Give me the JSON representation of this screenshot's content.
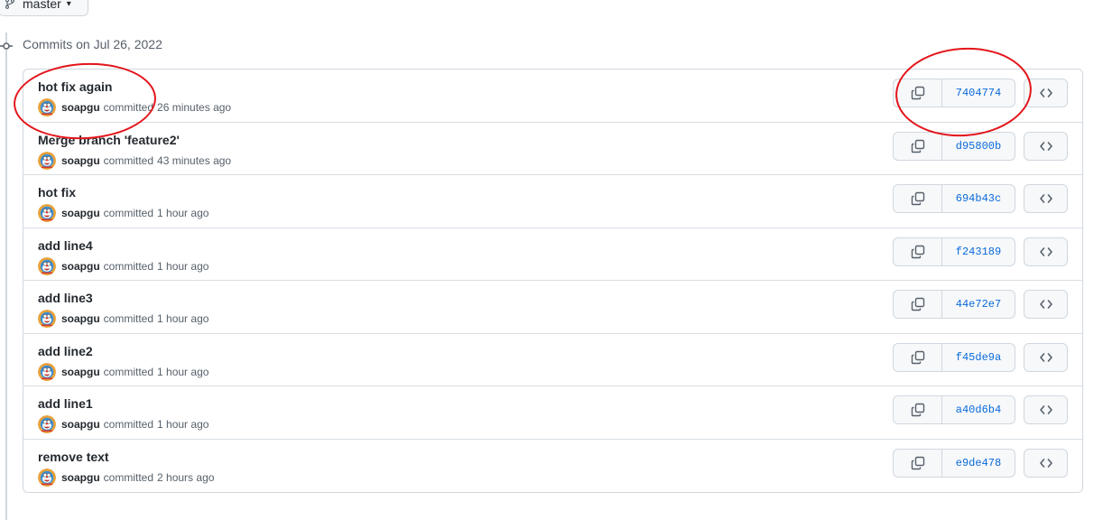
{
  "branch": {
    "name": "master"
  },
  "timeline": {
    "group_date_label": "Commits on Jul 26, 2022"
  },
  "colors": {
    "link": "#0969da",
    "annotation": "#e3151b",
    "border": "#d0d7de"
  },
  "commits": [
    {
      "title": "hot fix again",
      "author": "soapgu",
      "verb": "committed",
      "time": "26 minutes ago",
      "sha": "7404774"
    },
    {
      "title": "Merge branch 'feature2'",
      "author": "soapgu",
      "verb": "committed",
      "time": "43 minutes ago",
      "sha": "d95800b"
    },
    {
      "title": "hot fix",
      "author": "soapgu",
      "verb": "committed",
      "time": "1 hour ago",
      "sha": "694b43c"
    },
    {
      "title": "add line4",
      "author": "soapgu",
      "verb": "committed",
      "time": "1 hour ago",
      "sha": "f243189"
    },
    {
      "title": "add line3",
      "author": "soapgu",
      "verb": "committed",
      "time": "1 hour ago",
      "sha": "44e72e7"
    },
    {
      "title": "add line2",
      "author": "soapgu",
      "verb": "committed",
      "time": "1 hour ago",
      "sha": "f45de9a"
    },
    {
      "title": "add line1",
      "author": "soapgu",
      "verb": "committed",
      "time": "1 hour ago",
      "sha": "a40d6b4"
    },
    {
      "title": "remove text",
      "author": "soapgu",
      "verb": "committed",
      "time": "2 hours ago",
      "sha": "e9de478"
    }
  ],
  "icons": {
    "copy": "copy-icon",
    "browse": "code-icon",
    "branch": "git-branch-icon",
    "commit": "git-commit-icon"
  }
}
